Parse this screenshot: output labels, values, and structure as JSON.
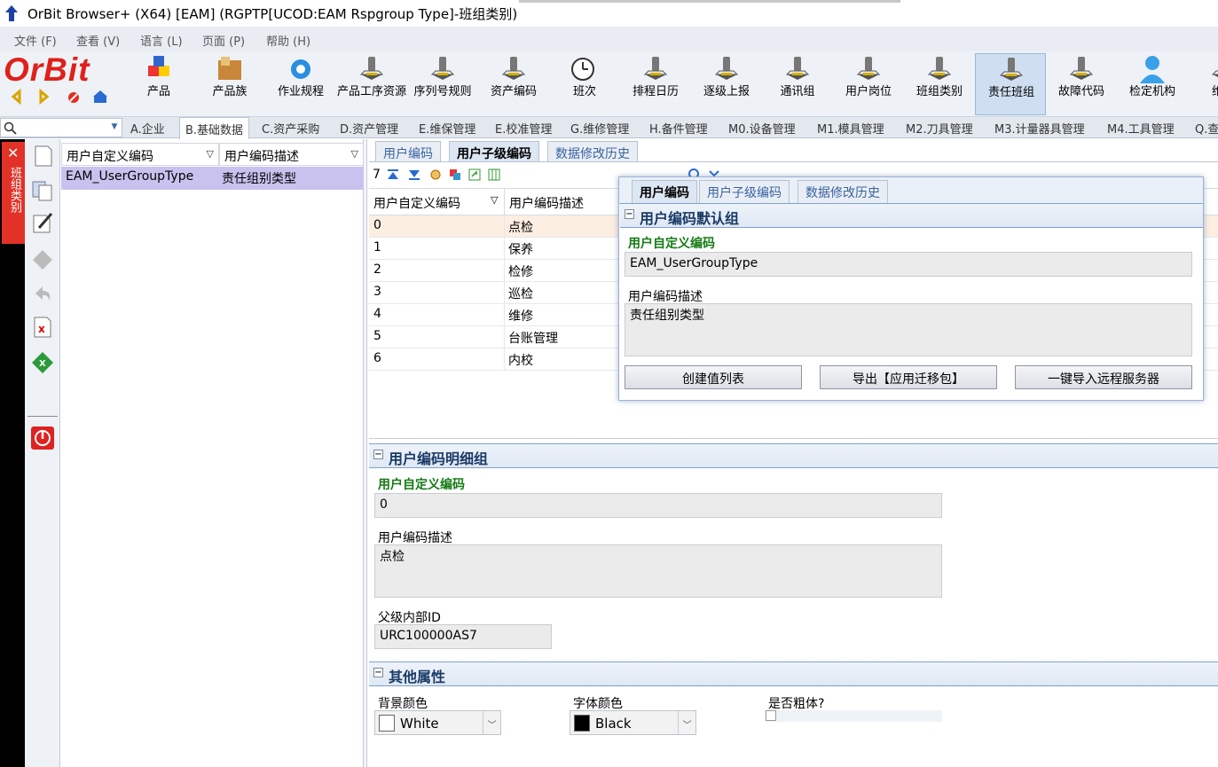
{
  "window": {
    "title": "OrBit Browser+ (X64) [EAM] (RGPTP[UCOD:EAM Rspgroup Type]-班组类别)"
  },
  "menu": [
    "文件 (F)",
    "查看 (V)",
    "语言 (L)",
    "页面 (P)",
    "帮助 (H)"
  ],
  "brand": "OrBit",
  "toolbar": [
    {
      "label": "产品",
      "icon": "cubes-icon"
    },
    {
      "label": "产品族",
      "icon": "box-icon"
    },
    {
      "label": "作业规程",
      "icon": "gear-icon"
    },
    {
      "label": "产品工序资源",
      "icon": "stamp-icon"
    },
    {
      "label": "序列号规则",
      "icon": "stamp-icon"
    },
    {
      "label": "资产编码",
      "icon": "stamp-icon"
    },
    {
      "label": "班次",
      "icon": "clock-icon"
    },
    {
      "label": "排程日历",
      "icon": "stamp-icon"
    },
    {
      "label": "逐级上报",
      "icon": "stamp-icon"
    },
    {
      "label": "通讯组",
      "icon": "stamp-icon"
    },
    {
      "label": "用户岗位",
      "icon": "stamp-icon"
    },
    {
      "label": "班组类别",
      "icon": "stamp-icon"
    },
    {
      "label": "责任班组",
      "icon": "stamp-icon"
    },
    {
      "label": "故障代码",
      "icon": "stamp-icon"
    },
    {
      "label": "检定机构",
      "icon": "user-icon"
    },
    {
      "label": "维保",
      "icon": "stamp-icon"
    }
  ],
  "module_tabs": [
    "A.企业",
    "B.基础数据",
    "C.资产采购",
    "D.资产管理",
    "E.维保管理",
    "E.校准管理",
    "G.维修管理",
    "H.备件管理",
    "M0.设备管理",
    "M1.模具管理",
    "M2.刀具管理",
    "M3.计量器具管理",
    "M4.工具管理",
    "Q.查"
  ],
  "side_tab": {
    "label": "班组类别"
  },
  "left_grid": {
    "headers": [
      "用户自定义编码",
      "用户编码描述"
    ],
    "rows": [
      [
        "EAM_UserGroupType",
        "责任组别类型"
      ]
    ]
  },
  "sub_tabs": [
    "用户编码",
    "用户子级编码",
    "数据修改历史"
  ],
  "grid_toolbar": {
    "count": "7"
  },
  "right_grid": {
    "headers": [
      "用户自定义编码",
      "用户编码描述"
    ],
    "rows": [
      [
        "0",
        "点检"
      ],
      [
        "1",
        "保养"
      ],
      [
        "2",
        "检修"
      ],
      [
        "3",
        "巡检"
      ],
      [
        "4",
        "维修"
      ],
      [
        "5",
        "台账管理"
      ],
      [
        "6",
        "内校"
      ]
    ]
  },
  "detail": {
    "section_title": "用户编码明细组",
    "code_label": "用户自定义编码",
    "code_value": "0",
    "desc_label": "用户编码描述",
    "desc_value": "点检",
    "parent_label": "父级内部ID",
    "parent_value": "URC100000AS7"
  },
  "other": {
    "section_title": "其他属性",
    "bg_label": "背景颜色",
    "bg_value": "White",
    "font_label": "字体颜色",
    "font_value": "Black",
    "bold_label": "是否粗体?"
  },
  "popup": {
    "tabs": [
      "用户编码",
      "用户子级编码",
      "数据修改历史"
    ],
    "section_title": "用户编码默认组",
    "code_label": "用户自定义编码",
    "code_value": "EAM_UserGroupType",
    "desc_label": "用户编码描述",
    "desc_value": "责任组别类型",
    "buttons": [
      "创建值列表",
      "导出【应用迁移包】",
      "一键导入远程服务器"
    ]
  },
  "colors": {
    "brand": "#e0201a",
    "selected_row": "#c9c2ef",
    "section_text": "#1a3a66",
    "green_label": "#147a14"
  }
}
